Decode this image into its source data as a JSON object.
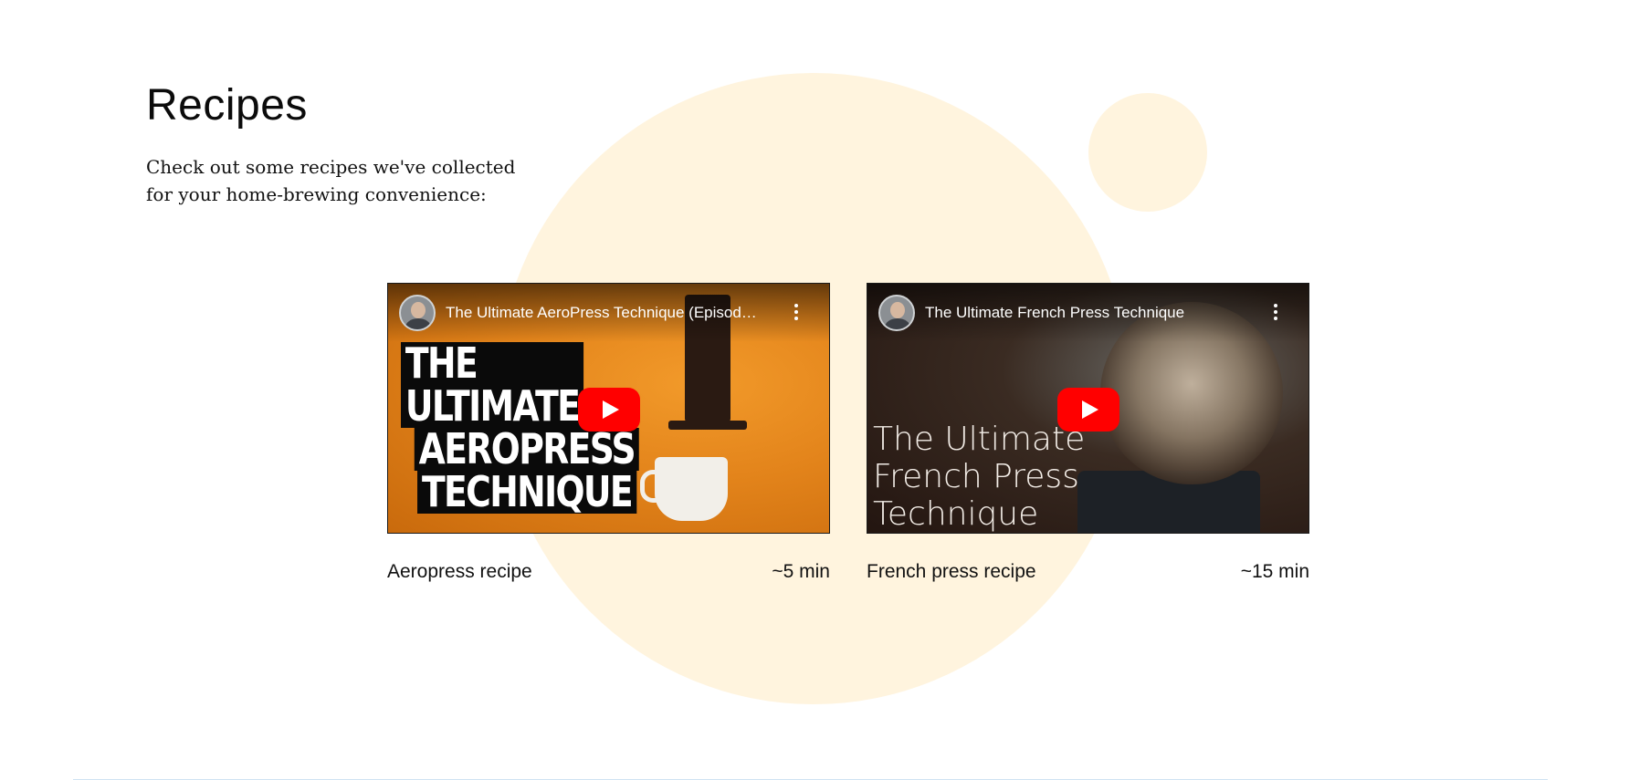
{
  "section": {
    "title": "Recipes",
    "intro": "Check out some recipes we've collected for your home-brewing convenience:"
  },
  "recipes": [
    {
      "video_title": "The Ultimate AeroPress Technique (Episod…",
      "thumbnail_lines": [
        "THE ULTIMATE",
        "AEROPRESS",
        "TECHNIQUE"
      ],
      "name": "Aeropress recipe",
      "duration": "~5 min"
    },
    {
      "video_title": "The Ultimate French Press Technique",
      "thumbnail_lines": [
        "The Ultimate",
        "French Press",
        "Technique"
      ],
      "name": "French press recipe",
      "duration": "~15 min"
    }
  ],
  "icons": {
    "play": "play-icon",
    "more": "more-vertical-icon",
    "channel": "channel-avatar"
  },
  "colors": {
    "accent_background": "#fff4de",
    "play_button": "#ff0000",
    "divider": "#cfe2f3"
  }
}
